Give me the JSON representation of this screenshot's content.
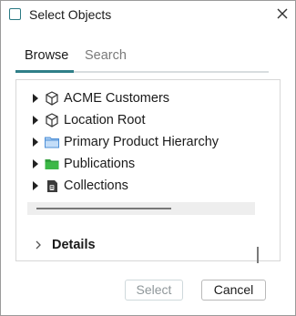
{
  "window": {
    "title": "Select Objects"
  },
  "tabs": [
    {
      "label": "Browse",
      "active": true
    },
    {
      "label": "Search",
      "active": false
    }
  ],
  "tree": {
    "items": [
      {
        "label": "ACME Customers",
        "icon": "cube-icon"
      },
      {
        "label": "Location Root",
        "icon": "cube-icon"
      },
      {
        "label": "Primary Product Hierarchy",
        "icon": "folder-blue-icon"
      },
      {
        "label": "Publications",
        "icon": "folder-green-icon"
      },
      {
        "label": "Collections",
        "icon": "collection-icon"
      }
    ]
  },
  "details": {
    "label": "Details"
  },
  "buttons": {
    "select_label": "Select",
    "cancel_label": "Cancel"
  },
  "colors": {
    "accent": "#2f7f88",
    "folder_blue": "#6aa8e8",
    "folder_green": "#3aa843"
  }
}
